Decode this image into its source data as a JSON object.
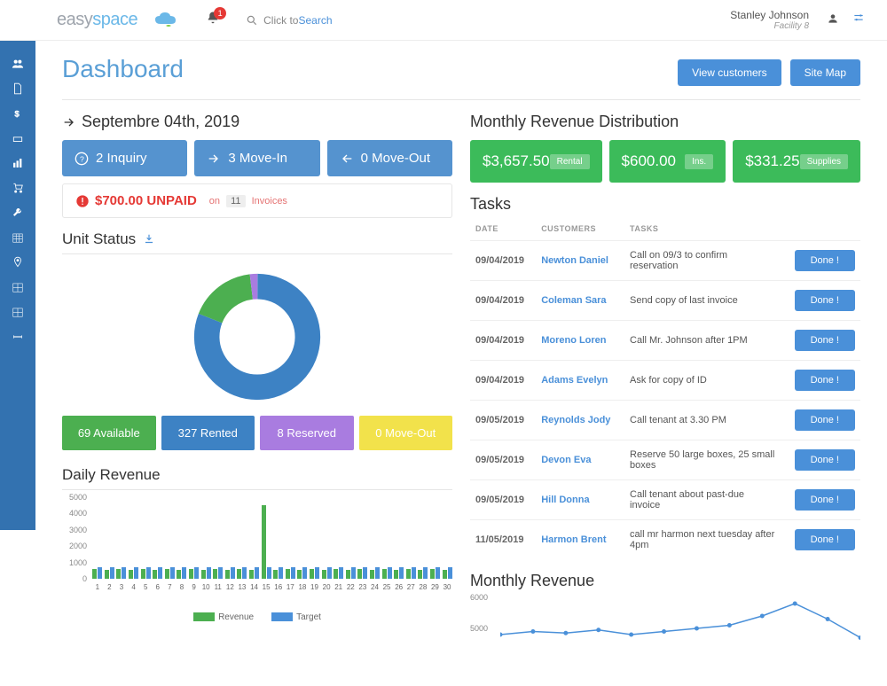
{
  "brand": {
    "part1": "easy",
    "part2": "space"
  },
  "header": {
    "notif_count": "1",
    "search_prefix": "Click to ",
    "search_word": "Search",
    "user_name": "Stanley Johnson",
    "facility": "Facility 8"
  },
  "buttons": {
    "view_customers": "View customers",
    "site_map": "Site Map"
  },
  "page_title": "Dashboard",
  "date_label": "Septembre 04th, 2019",
  "stat_cards": {
    "inquiry": "2 Inquiry",
    "movein": "3 Move-In",
    "moveout": "0 Move-Out"
  },
  "unpaid": {
    "amount": "$700.00 UNPAID",
    "prefix": "on",
    "count": "11",
    "suffix": "Invoices"
  },
  "unit_status": {
    "title": "Unit Status",
    "available": "69 Available",
    "rented": "327 Rented",
    "reserved": "8 Reserved",
    "moveout": "0 Move-Out"
  },
  "daily_revenue_title": "Daily Revenue",
  "daily_legend": {
    "revenue": "Revenue",
    "target": "Target"
  },
  "monthly_dist": {
    "title": "Monthly Revenue Distribution",
    "rental_amount": "$3,657.50",
    "rental_tag": "Rental",
    "ins_amount": "$600.00",
    "ins_tag": "Ins.",
    "supplies_amount": "$331.25",
    "supplies_tag": "Supplies"
  },
  "tasks": {
    "title": "Tasks",
    "col_date": "DATE",
    "col_customers": "CUSTOMERS",
    "col_tasks": "TASKS",
    "done_label": "Done !",
    "rows": [
      {
        "date": "09/04/2019",
        "customer": "Newton Daniel",
        "task": "Call on 09/3 to confirm reservation"
      },
      {
        "date": "09/04/2019",
        "customer": "Coleman Sara",
        "task": "Send copy of last invoice"
      },
      {
        "date": "09/04/2019",
        "customer": "Moreno Loren",
        "task": "Call Mr. Johnson after 1PM"
      },
      {
        "date": "09/04/2019",
        "customer": "Adams Evelyn",
        "task": "Ask for copy of ID"
      },
      {
        "date": "09/05/2019",
        "customer": "Reynolds Jody",
        "task": "Call tenant at 3.30 PM"
      },
      {
        "date": "09/05/2019",
        "customer": "Devon Eva",
        "task": "Reserve 50 large boxes, 25 small boxes"
      },
      {
        "date": "09/05/2019",
        "customer": "Hill Donna",
        "task": "Call tenant about past-due invoice"
      },
      {
        "date": "11/05/2019",
        "customer": "Harmon Brent",
        "task": "call mr harmon next tuesday after 4pm"
      }
    ]
  },
  "monthly_revenue_title": "Monthly Revenue",
  "chart_data": [
    {
      "type": "donut",
      "title": "Unit Status",
      "series": [
        {
          "name": "Rented",
          "value": 327,
          "color": "#3d82c4"
        },
        {
          "name": "Available",
          "value": 69,
          "color": "#4caf50"
        },
        {
          "name": "Reserved",
          "value": 8,
          "color": "#a97ce0"
        },
        {
          "name": "Move-Out",
          "value": 0,
          "color": "#f2e24b"
        }
      ]
    },
    {
      "type": "bar",
      "title": "Daily Revenue",
      "xlabel": "",
      "ylabel": "",
      "ylim": [
        0,
        5000
      ],
      "yticks": [
        0,
        1000,
        2000,
        3000,
        4000,
        5000
      ],
      "categories": [
        1,
        2,
        3,
        4,
        5,
        6,
        7,
        8,
        9,
        10,
        11,
        12,
        13,
        14,
        15,
        16,
        17,
        18,
        19,
        20,
        21,
        22,
        23,
        24,
        25,
        26,
        27,
        28,
        29,
        30
      ],
      "series": [
        {
          "name": "Revenue",
          "color": "#4caf50",
          "values": [
            600,
            550,
            600,
            550,
            600,
            550,
            600,
            550,
            600,
            550,
            600,
            550,
            600,
            550,
            4500,
            550,
            600,
            550,
            600,
            550,
            600,
            550,
            600,
            550,
            600,
            550,
            600,
            550,
            600,
            550
          ]
        },
        {
          "name": "Target",
          "color": "#4a90d9",
          "values": [
            700,
            700,
            700,
            700,
            700,
            700,
            700,
            700,
            700,
            700,
            700,
            700,
            700,
            700,
            700,
            700,
            700,
            700,
            700,
            700,
            700,
            700,
            700,
            700,
            700,
            700,
            700,
            700,
            700,
            700
          ]
        }
      ]
    },
    {
      "type": "line",
      "title": "Monthly Revenue",
      "ylim": [
        4000,
        6000
      ],
      "yticks": [
        5000,
        6000
      ],
      "x": [
        1,
        2,
        3,
        4,
        5,
        6,
        7,
        8,
        9,
        10,
        11,
        12
      ],
      "series": [
        {
          "name": "Revenue",
          "color": "#4a90d9",
          "values": [
            4800,
            4900,
            4850,
            4950,
            4800,
            4900,
            5000,
            5100,
            5400,
            5800,
            5300,
            4700
          ]
        }
      ]
    }
  ]
}
